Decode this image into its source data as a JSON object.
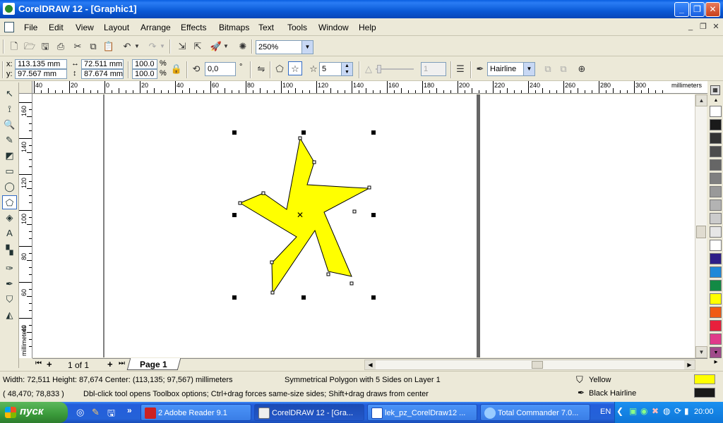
{
  "window": {
    "title": "CorelDRAW 12 - [Graphic1]"
  },
  "menu": [
    "File",
    "Edit",
    "View",
    "Layout",
    "Arrange",
    "Effects",
    "Bitmaps",
    "Text",
    "Tools",
    "Window",
    "Help"
  ],
  "toolbar": {
    "zoom": "250%"
  },
  "property_bar": {
    "x": "113.135 mm",
    "y": "97.567 mm",
    "w": "72.511 mm",
    "h": "87.674 mm",
    "scale_x": "100.0",
    "scale_y": "100.0",
    "pct": "%",
    "angle": "0,0",
    "deg": "°",
    "sides": "5",
    "sharpness": "1",
    "outline": "Hairline"
  },
  "ruler": {
    "units": "millimeters",
    "h_labels": [
      "40",
      "20",
      "0",
      "20",
      "40",
      "60",
      "80",
      "100",
      "120",
      "140",
      "160",
      "180",
      "200",
      "220",
      "240",
      "260",
      "280",
      "300"
    ],
    "v_labels": [
      "160",
      "140",
      "120",
      "100",
      "80",
      "60",
      "40"
    ],
    "v_units": "millimeters"
  },
  "pages": {
    "counter": "1 of 1",
    "tab": "Page 1"
  },
  "status": {
    "dims": "Width: 72,511  Height: 87,674  Center: (113,135; 97,567)  millimeters",
    "object": "Symmetrical Polygon with 5 Sides on Layer 1",
    "fill_name": "Yellow",
    "outline_name": "Black  Hairline",
    "coords": "( 48,470; 78,833 )",
    "hint": "Dbl-click tool opens Toolbox options; Ctrl+drag forces same-size sides; Shift+drag draws from center"
  },
  "colors": {
    "fill": "#ffff00",
    "outline": "#1a1a1a",
    "palette": [
      "#ffffff",
      "#1a1a1a",
      "#333333",
      "#4d4d4d",
      "#666666",
      "#808080",
      "#999999",
      "#b3b3b3",
      "#cccccc",
      "#e6e6e6",
      "#ffffff",
      "#2e1f88",
      "#1f88d8",
      "#138a45",
      "#ffff00",
      "#f05a14",
      "#e8203c",
      "#e03a8a",
      "#a04a8a"
    ]
  },
  "taskbar": {
    "start": "пуск",
    "tasks": [
      {
        "label": "2 Adobe Reader 9.1",
        "active": false
      },
      {
        "label": "CorelDRAW 12 - [Gra...",
        "active": true
      },
      {
        "label": "lek_pz_CorelDraw12 ...",
        "active": false
      },
      {
        "label": "Total Commander 7.0...",
        "active": false
      }
    ],
    "lang": "EN",
    "clock": "20:00"
  }
}
